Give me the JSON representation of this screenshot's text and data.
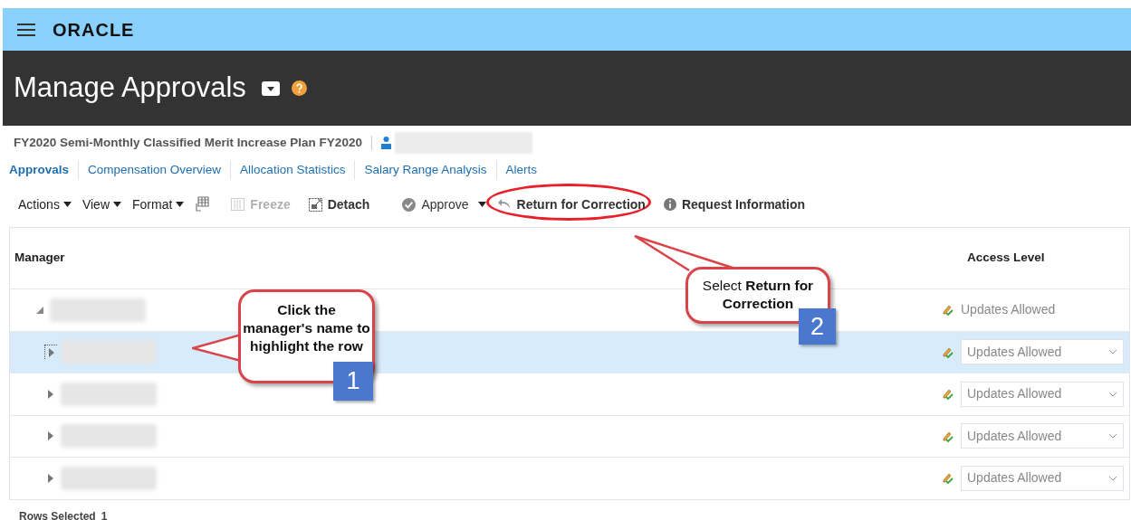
{
  "brand": {
    "logo": "ORACLE"
  },
  "page": {
    "title": "Manage Approvals"
  },
  "plan": {
    "name": "FY2020 Semi-Monthly Classified Merit Increase Plan FY2020"
  },
  "tabs": [
    {
      "label": "Approvals",
      "selected": true
    },
    {
      "label": "Compensation Overview",
      "selected": false
    },
    {
      "label": "Allocation Statistics",
      "selected": false
    },
    {
      "label": "Salary Range Analysis",
      "selected": false
    },
    {
      "label": "Alerts",
      "selected": false
    }
  ],
  "toolbar": [
    {
      "kind": "menu",
      "label": "Actions"
    },
    {
      "kind": "menu",
      "label": "View"
    },
    {
      "kind": "menu",
      "label": "Format"
    },
    {
      "kind": "icon"
    },
    {
      "kind": "freeze",
      "label": "Freeze",
      "disabled": true
    },
    {
      "kind": "detach",
      "label": "Detach",
      "disabled": false
    },
    {
      "kind": "approve",
      "label": "Approve"
    },
    {
      "kind": "return",
      "label": "Return for Correction",
      "highlighted": true
    },
    {
      "kind": "info",
      "label": "Request Information"
    }
  ],
  "table": {
    "columns": [
      "Manager",
      "Access Level"
    ],
    "rows": [
      {
        "expanded": true,
        "selected": false,
        "access": {
          "kind": "text",
          "value": "Updates Allowed"
        }
      },
      {
        "expanded": false,
        "selected": true,
        "access": {
          "kind": "select",
          "value": "Updates Allowed"
        }
      },
      {
        "expanded": false,
        "selected": false,
        "access": {
          "kind": "select",
          "value": "Updates Allowed"
        }
      },
      {
        "expanded": false,
        "selected": false,
        "access": {
          "kind": "select",
          "value": "Updates Allowed"
        }
      },
      {
        "expanded": false,
        "selected": false,
        "access": {
          "kind": "select",
          "value": "Updates Allowed"
        }
      }
    ]
  },
  "footer": {
    "label": "Rows Selected",
    "count": "1"
  },
  "callouts": [
    {
      "text": "Click the manager's name to highlight the row",
      "step": "1"
    },
    {
      "text": "Select **Return for Correction**",
      "step": "2"
    }
  ]
}
